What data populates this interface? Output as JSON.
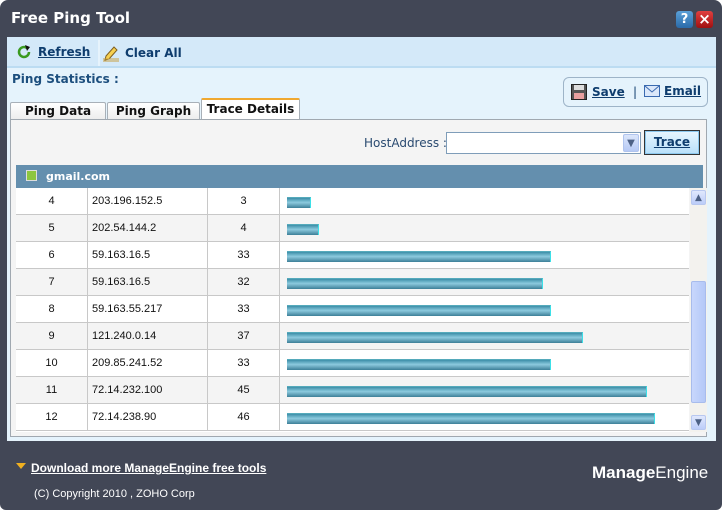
{
  "window": {
    "title": "Free Ping Tool",
    "help_icon": "?",
    "close_icon": "×"
  },
  "toolbar": {
    "refresh_label": "Refresh",
    "clear_all_label": "Clear All"
  },
  "ping_statistics_label": "Ping Statistics :",
  "tabs": [
    {
      "label": "Ping Data",
      "active": false
    },
    {
      "label": "Ping Graph",
      "active": false
    },
    {
      "label": "Trace Details",
      "active": true
    }
  ],
  "actions": {
    "save_label": "Save",
    "email_label": "Email",
    "separator": "|"
  },
  "trace": {
    "host_label": "HostAddress :",
    "host_value": "",
    "trace_button": "Trace"
  },
  "group": {
    "name": "gmail.com",
    "color": "#8dc63f"
  },
  "rows": [
    {
      "hop": "4",
      "ip": "203.196.152.5",
      "time": "3"
    },
    {
      "hop": "5",
      "ip": "202.54.144.2",
      "time": "4"
    },
    {
      "hop": "6",
      "ip": "59.163.16.5",
      "time": "33"
    },
    {
      "hop": "7",
      "ip": "59.163.16.5",
      "time": "32"
    },
    {
      "hop": "8",
      "ip": "59.163.55.217",
      "time": "33"
    },
    {
      "hop": "9",
      "ip": "121.240.0.14",
      "time": "37"
    },
    {
      "hop": "10",
      "ip": "209.85.241.52",
      "time": "33"
    },
    {
      "hop": "11",
      "ip": "72.14.232.100",
      "time": "45"
    },
    {
      "hop": "12",
      "ip": "72.14.238.90",
      "time": "46"
    }
  ],
  "footer": {
    "download_link": "Download more ManageEngine free tools",
    "copyright": "(C) Copyright 2010 , ZOHO Corp",
    "logo_text": "ManageEngine"
  },
  "colors": {
    "frame": "#424756",
    "header": "#648fae",
    "bar": "#4a97b0"
  }
}
